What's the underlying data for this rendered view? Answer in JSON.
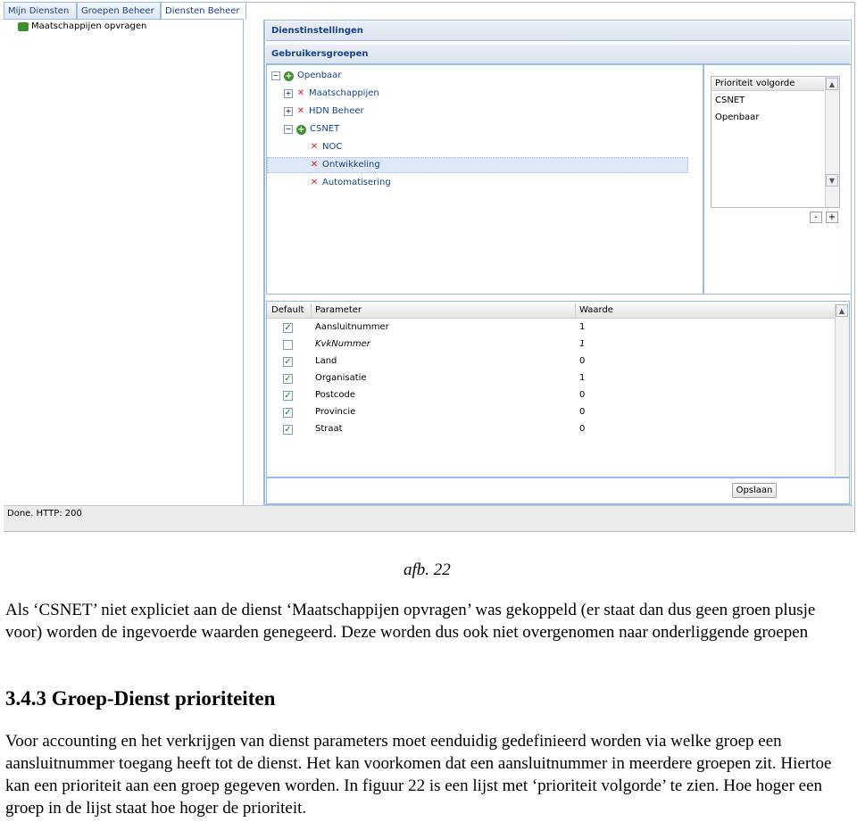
{
  "tabs": [
    "Mijn Diensten",
    "Groepen Beheer",
    "Diensten Beheer"
  ],
  "left_tree": {
    "item": "Maatschappijen opvragen"
  },
  "panel": {
    "title": "Dienstinstellingen",
    "subtitle": "Gebruikersgroepen"
  },
  "groups": {
    "root": "Openbaar",
    "children": [
      "Maatschappijen",
      "HDN Beheer",
      "CSNET"
    ],
    "csnet_children": [
      "NOC",
      "Ontwikkeling",
      "Automatisering"
    ]
  },
  "priority": {
    "header": "Prioriteit volgorde",
    "items": [
      "CSNET",
      "Openbaar"
    ],
    "minus": "-",
    "plus": "+"
  },
  "grid": {
    "columns": [
      "Default",
      "Parameter",
      "Waarde"
    ],
    "rows": [
      {
        "checked": true,
        "parameter": "Aansluitnummer",
        "waarde": "1"
      },
      {
        "checked": false,
        "parameter": "KvkNummer",
        "waarde": "1"
      },
      {
        "checked": true,
        "parameter": "Land",
        "waarde": "0"
      },
      {
        "checked": true,
        "parameter": "Organisatie",
        "waarde": "1"
      },
      {
        "checked": true,
        "parameter": "Postcode",
        "waarde": "0"
      },
      {
        "checked": true,
        "parameter": "Provincie",
        "waarde": "0"
      },
      {
        "checked": true,
        "parameter": "Straat",
        "waarde": "0"
      }
    ]
  },
  "save_label": "Opslaan",
  "status": "Done. HTTP: 200",
  "document": {
    "caption": "afb. 22",
    "para1": "Als ‘CSNET’ niet expliciet aan de dienst ‘Maatschappijen opvragen’ was gekoppeld (er staat dan dus geen groen plusje voor) worden de ingevoerde waarden genegeerd. Deze worden dus ook niet overgenomen naar onderliggende groepen",
    "heading": "3.4.3 Groep-Dienst prioriteiten",
    "para2": "Voor accounting en het verkrijgen van dienst parameters moet eenduidig gedefinieerd worden via welke groep een aansluitnummer toegang heeft tot de dienst. Het kan voorkomen dat een aansluitnummer in meerdere groepen zit. Hiertoe kan een prioriteit aan een groep gegeven worden. In figuur 22 is een lijst met ‘prioriteit volgorde’ te zien.  Hoe hoger een groep in de lijst staat hoe hoger de prioriteit."
  },
  "colors": {
    "header_text": "#15428b",
    "border": "#99bbe8",
    "selection": "#dfe8f6",
    "check": "#1a7a1a",
    "ok_icon": "#3f8f2a",
    "error_icon": "#dd2222"
  }
}
